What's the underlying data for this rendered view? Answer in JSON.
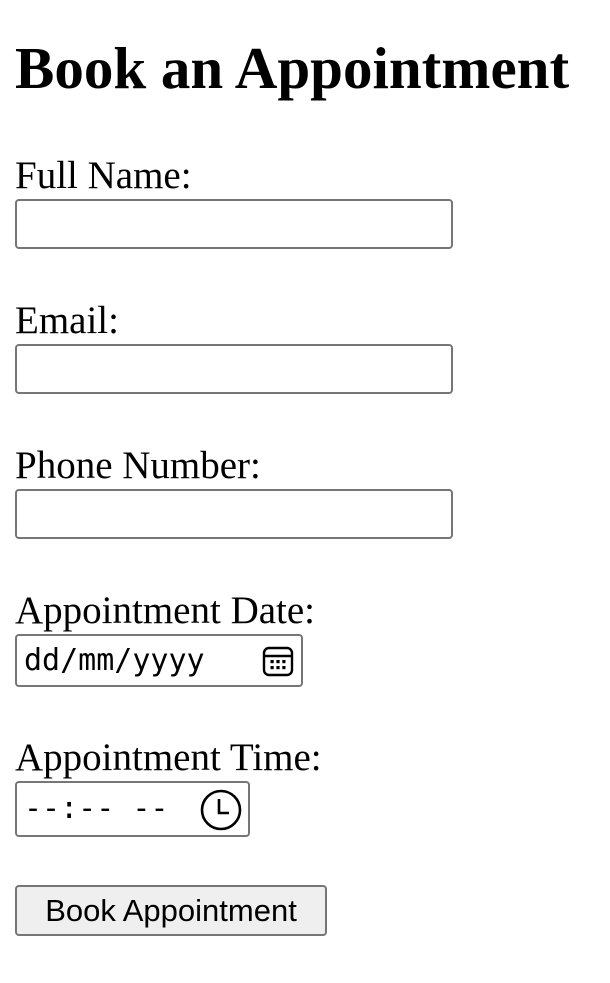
{
  "form": {
    "title": "Book an Appointment",
    "full_name": {
      "label": "Full Name:",
      "value": ""
    },
    "email": {
      "label": "Email:",
      "value": ""
    },
    "phone": {
      "label": "Phone Number:",
      "value": ""
    },
    "date": {
      "label": "Appointment Date:",
      "placeholder_text": "dd/mm/yyyy",
      "icon": "calendar-icon"
    },
    "time": {
      "label": "Appointment Time:",
      "placeholder_text": "--:-- --",
      "icon": "clock-icon"
    },
    "submit_label": "Book Appointment"
  },
  "colors": {
    "text": "#000000",
    "input_border": "#767676",
    "button_background": "#efefef",
    "page_background": "#ffffff"
  }
}
